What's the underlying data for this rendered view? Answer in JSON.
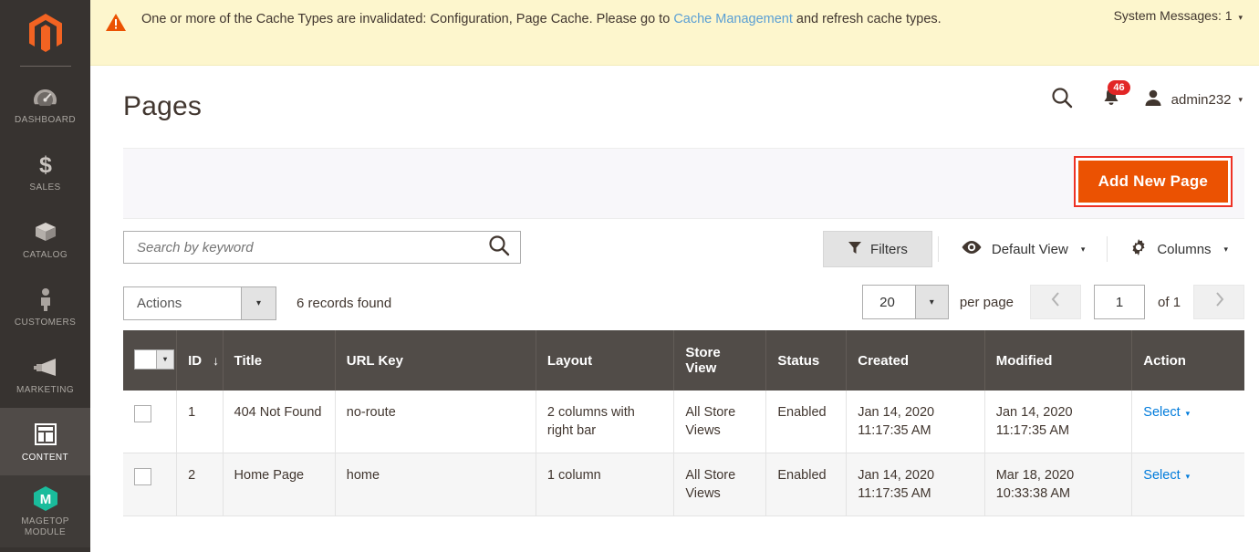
{
  "sidebar": {
    "logo_name": "magento-logo-icon",
    "items": [
      {
        "label": "DASHBOARD",
        "icon": "dashboard-gauge-icon",
        "active": false
      },
      {
        "label": "SALES",
        "icon": "dollar-sign-icon",
        "active": false
      },
      {
        "label": "CATALOG",
        "icon": "box-icon",
        "active": false
      },
      {
        "label": "CUSTOMERS",
        "icon": "person-icon",
        "active": false
      },
      {
        "label": "MARKETING",
        "icon": "megaphone-icon",
        "active": false
      },
      {
        "label": "CONTENT",
        "icon": "layout-panel-icon",
        "active": true
      },
      {
        "label": "MAGETOP MODULE",
        "icon": "magetop-cube-icon",
        "active": false
      }
    ]
  },
  "banner": {
    "icon": "warning-triangle-icon",
    "text_before": "One or more of the Cache Types are invalidated: Configuration, Page Cache. Please go to ",
    "link_text": "Cache Management",
    "text_after": " and refresh cache types.",
    "system_messages_label": "System Messages: 1",
    "caret": "▾"
  },
  "header": {
    "title": "Pages",
    "search_icon": "search-icon",
    "notifications_icon": "bell-icon",
    "notifications_count": "46",
    "user_icon": "user-avatar-icon",
    "user_name": "admin232",
    "user_caret": "▾"
  },
  "page_actions": {
    "add_new_page_label": "Add New Page",
    "highlight_color": "#ee3124",
    "button_color": "#eb5202"
  },
  "grid_toolbar": {
    "search_placeholder": "Search by keyword",
    "search_value": "",
    "search_icon": "search-icon",
    "filters_label": "Filters",
    "filters_icon": "funnel-icon",
    "view_label": "Default View",
    "view_icon": "eye-icon",
    "view_caret": "▾",
    "columns_label": "Columns",
    "columns_icon": "gear-icon",
    "columns_caret": "▾"
  },
  "actions_row": {
    "actions_label": "Actions",
    "actions_caret": "▾",
    "records_found": "6 records found",
    "per_page_value": "20",
    "per_page_caret": "▾",
    "per_page_label": "per page",
    "prev_icon": "chevron-left-icon",
    "next_icon": "chevron-right-icon",
    "current_page": "1",
    "of_label": "of 1"
  },
  "grid": {
    "select_all_caret": "▾",
    "sort_arrow": "↓",
    "columns": [
      {
        "key": "check",
        "label": ""
      },
      {
        "key": "id",
        "label": "ID"
      },
      {
        "key": "title",
        "label": "Title"
      },
      {
        "key": "url_key",
        "label": "URL Key"
      },
      {
        "key": "layout",
        "label": "Layout"
      },
      {
        "key": "store_view",
        "label": "Store View"
      },
      {
        "key": "status",
        "label": "Status"
      },
      {
        "key": "created",
        "label": "Created"
      },
      {
        "key": "modified",
        "label": "Modified"
      },
      {
        "key": "action",
        "label": "Action"
      }
    ],
    "rows": [
      {
        "id": "1",
        "title": "404 Not Found",
        "url_key": "no-route",
        "layout": "2 columns with right bar",
        "store_view": "All Store Views",
        "status": "Enabled",
        "created_date": "Jan 14, 2020",
        "created_time": "11:17:35 AM",
        "modified_date": "Jan 14, 2020",
        "modified_time": "11:17:35 AM",
        "action_label": "Select",
        "action_caret": "▾"
      },
      {
        "id": "2",
        "title": "Home Page",
        "url_key": "home",
        "layout": "1 column",
        "store_view": "All Store Views",
        "status": "Enabled",
        "created_date": "Jan 14, 2020",
        "created_time": "11:17:35 AM",
        "modified_date": "Mar 18, 2020",
        "modified_time": "10:33:38 AM",
        "action_label": "Select",
        "action_caret": "▾"
      }
    ]
  }
}
